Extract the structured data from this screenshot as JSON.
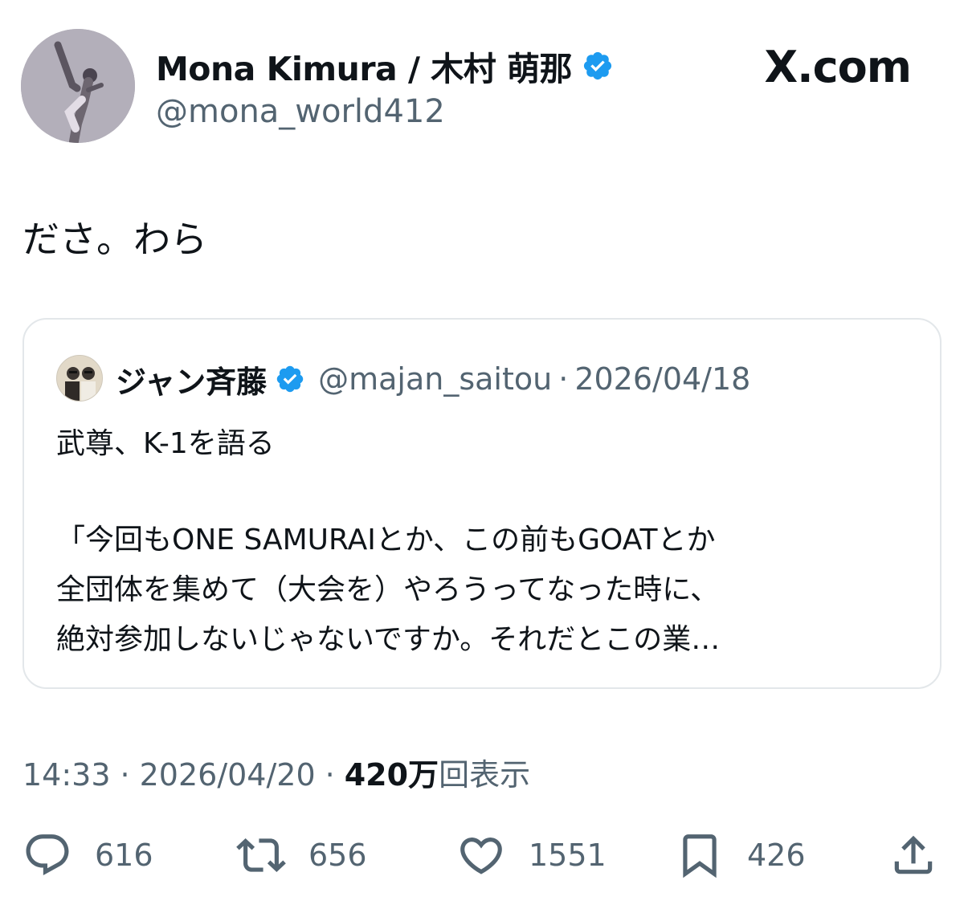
{
  "author": {
    "display_name": "Mona Kimura / 木村 萌那",
    "handle": "@mona_world412",
    "verified": true
  },
  "site_logo": "X.com",
  "tweet": {
    "text": "ださ。わら"
  },
  "quoted": {
    "display_name": "ジャン斉藤",
    "handle": "@majan_saitou",
    "separator": "·",
    "date": "2026/04/18",
    "lines": [
      "武尊、K-1を語る",
      "「今回もONE SAMURAIとか、この前もGOATとか",
      "全団体を集めて（大会を）やろうってなった時に、",
      "絶対参加しないじゃないですか。それだとこの業…"
    ]
  },
  "meta": {
    "time": "14:33",
    "separator": "·",
    "date": "2026/04/20",
    "views_count": "420万",
    "views_label": "回表示"
  },
  "actions": {
    "replies": "616",
    "retweets": "656",
    "likes": "1551",
    "bookmarks": "426"
  },
  "colors": {
    "verified_blue": "#1d9bf0",
    "text_primary": "#0f1419",
    "text_secondary": "#536471",
    "border": "#e3e7ea"
  },
  "icons": [
    "verified-badge-icon",
    "reply-icon",
    "retweet-icon",
    "like-icon",
    "bookmark-icon",
    "share-icon"
  ]
}
